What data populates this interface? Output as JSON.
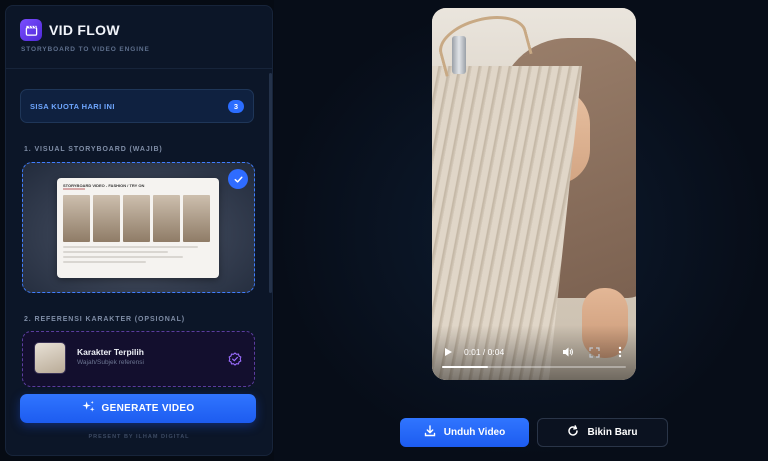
{
  "brand": {
    "title": "VID FLOW",
    "subtitle": "STORYBOARD TO VIDEO ENGINE",
    "logo_icon": "clapperboard-icon",
    "accent": "#6b3ff0"
  },
  "quota": {
    "label": "SISA KUOTA HARI INI",
    "count": "3",
    "color": "#2b6dff"
  },
  "storyboard": {
    "section_title": "1. VISUAL STORYBOARD (WAJIB)",
    "card_heading": "STORYBOARD VIDEO - FASHION / TRY ON",
    "selected": true
  },
  "character": {
    "section_title": "2. REFERENSI KARAKTER (OPSIONAL)",
    "name": "Karakter Terpilih",
    "hint": "Wajah/Subjek referensi",
    "selected": true
  },
  "actions": {
    "generate_label": "GENERATE VIDEO",
    "generate_icon": "sparkles-icon",
    "footer": "PRESENT BY ILHAM DIGITAL",
    "download_label": "Unduh Video",
    "new_label": "Bikin Baru"
  },
  "video": {
    "current_time": "0:01",
    "duration": "0:04",
    "time_display": "0:01 / 0:04",
    "progress": 0.25
  }
}
